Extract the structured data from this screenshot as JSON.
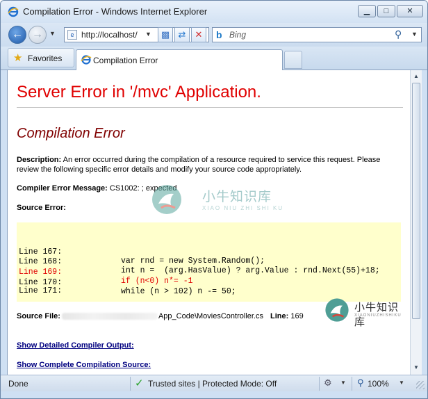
{
  "window": {
    "title": "Compilation Error - Windows Internet Explorer",
    "minimize": "▁",
    "maximize": "□",
    "close": "✕"
  },
  "nav": {
    "address": "http://localhost/",
    "search_placeholder": "Bing",
    "search_icon": "⚲"
  },
  "favorites_bar": {
    "favorites_label": "Favorites",
    "tab_label": "Compilation Error"
  },
  "page": {
    "server_error_heading": "Server Error in '/mvc' Application.",
    "compilation_heading": "Compilation Error",
    "description_label": "Description:",
    "description_text": " An error occurred during the compilation of a resource required to service this request. Please review the following specific error details and modify your source code appropriately.",
    "compiler_message_label": "Compiler Error Message:",
    "compiler_message_value": " CS1002: ; expected",
    "source_error_label": "Source Error:",
    "code_lines": [
      {
        "number": "Line 167:",
        "code": "var rnd = new System.Random();",
        "error": false
      },
      {
        "number": "Line 168:",
        "code": "int n =  (arg.HasValue) ? arg.Value : rnd.Next(55)+18;",
        "error": false
      },
      {
        "number": "Line 169:",
        "code": "if (n<0) n*= -1",
        "error": true
      },
      {
        "number": "Line 170:",
        "code": "while (n > 102) n -= 50;",
        "error": false
      },
      {
        "number": "Line 171:",
        "code": "",
        "error": false
      }
    ],
    "source_file_label": "Source File:",
    "source_file_path_visible": "App_Code\\MoviesController.cs",
    "line_label": "Line:",
    "line_value": " 169",
    "link_detailed_output": "Show Detailed Compiler Output:",
    "link_complete_source": "Show Complete Compilation Source:"
  },
  "watermark": {
    "cn": "小牛知识库",
    "en": "XIAO NIU ZHI SHI KU",
    "en_small": "XIAONIUZHISHIKU"
  },
  "status": {
    "done": "Done",
    "zone": "Trusted sites | Protected Mode: Off",
    "zoom": "100%"
  }
}
